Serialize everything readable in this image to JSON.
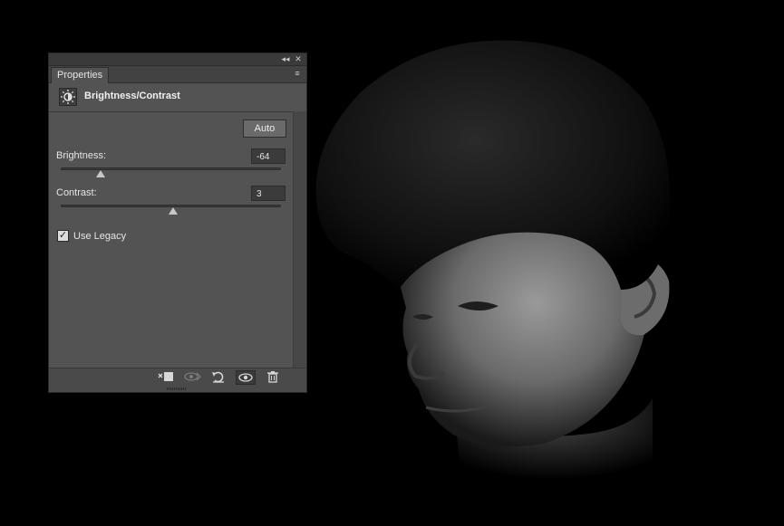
{
  "panel": {
    "tab_label": "Properties",
    "collapse_glyph": "◂◂",
    "close_glyph": "✕",
    "menu_glyph": "≡",
    "adjustment_icon": "brightness-contrast-icon",
    "title": "Brightness/Contrast",
    "auto_label": "Auto",
    "brightness": {
      "label": "Brightness:",
      "value": "-64",
      "slider_fraction": 0.18
    },
    "contrast": {
      "label": "Contrast:",
      "value": "3",
      "slider_fraction": 0.51
    },
    "use_legacy": {
      "label": "Use Legacy",
      "checked": true,
      "check_glyph": "✓"
    },
    "footer_icons": [
      {
        "name": "clip-to-layer-icon",
        "glyph": "⧉",
        "enabled": true
      },
      {
        "name": "view-previous-state-icon",
        "glyph": "👁",
        "enabled": false
      },
      {
        "name": "reset-icon",
        "glyph": "↺",
        "enabled": true
      },
      {
        "name": "visibility-eye-icon",
        "glyph": "◉",
        "enabled": true
      },
      {
        "name": "trash-icon",
        "glyph": "🗑",
        "enabled": true
      }
    ]
  },
  "colors": {
    "panel_bg": "#535353",
    "canvas_bg": "#000000",
    "text": "#e6e6e6"
  }
}
